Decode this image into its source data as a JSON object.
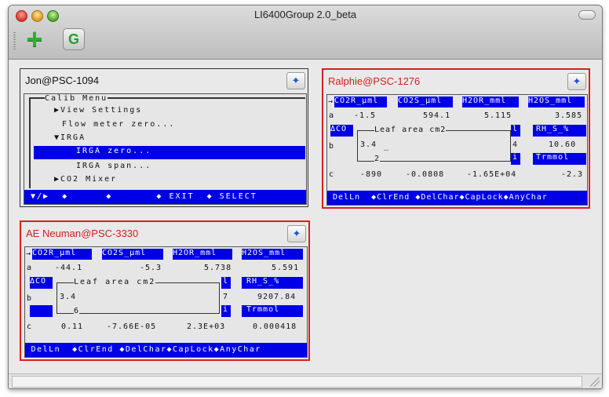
{
  "window": {
    "title": "LI6400Group 2.0_beta"
  },
  "toolbar": {
    "add_icon": "plus-icon",
    "g_label": "G"
  },
  "panels": {
    "jon": {
      "title": "Jon@PSC-1094",
      "menu_header": "Calib Menu",
      "items": [
        "▶View Settings",
        "Flow meter zero...",
        "▼IRGA",
        "IRGA zero...",
        "IRGA span...",
        "▶CO2 Mixer"
      ],
      "bottom": " ▼/▶  ◆      ◆       ◆ EXIT  ◆ SELECT"
    },
    "ralphie": {
      "title": "Ralphie@PSC-1276",
      "headers": [
        "CO2R_µml",
        "CO2S_µml",
        "H2OR_mml",
        "H2OS_mml"
      ],
      "row_a": {
        "label": "a",
        "values": [
          "-1.5",
          "594.1",
          "5.115",
          "3.585"
        ]
      },
      "dco": "ΔCO",
      "leaf_label": "Leaf area cm2",
      "leaf_value": "3.4",
      "leaf_cursor": "_",
      "leaf_bottom": "2",
      "l_key": "l",
      "four": "4",
      "i_key": "i",
      "rh_label": "RH_S_%",
      "rh_value": "10.60",
      "trmmol": "Trmmol",
      "b_label": "b",
      "row_c": {
        "label": "c",
        "values": [
          "-890",
          "-0.0808",
          "-1.65E+04",
          "-2.3"
        ]
      },
      "bottom": " DelLn  ◆ClrEnd ◆DelChar◆CapLock◆AnyChar"
    },
    "ae": {
      "title": "AE Neuman@PSC-3330",
      "headers": [
        "CO2R_µml",
        "CO2S_µml",
        "H2OR_mml",
        "H2OS_mml"
      ],
      "row_a": {
        "label": "a",
        "values": [
          "-44.1",
          "-5.3",
          "5.738",
          "5.591"
        ]
      },
      "dco": "ΔCO",
      "leaf_label": "Leaf area cm2",
      "leaf_value": "3.4",
      "leaf_bottom": "6",
      "l_key": "l",
      "seven": "7",
      "i_key": "i",
      "rh_label": "RH_S_%",
      "rh_value": "9207.84",
      "trmmol": "Trmmol",
      "b_label": "b",
      "row_c": {
        "label": "c",
        "values": [
          "0.11",
          "-7.66E-05",
          "2.3E+03",
          "0.000418"
        ]
      },
      "bottom": " DelLn  ◆ClrEnd ◆DelChar◆CapLock◆AnyChar"
    }
  },
  "colors": {
    "lcd_highlight": "#0000e6",
    "red_border": "#d62020"
  }
}
